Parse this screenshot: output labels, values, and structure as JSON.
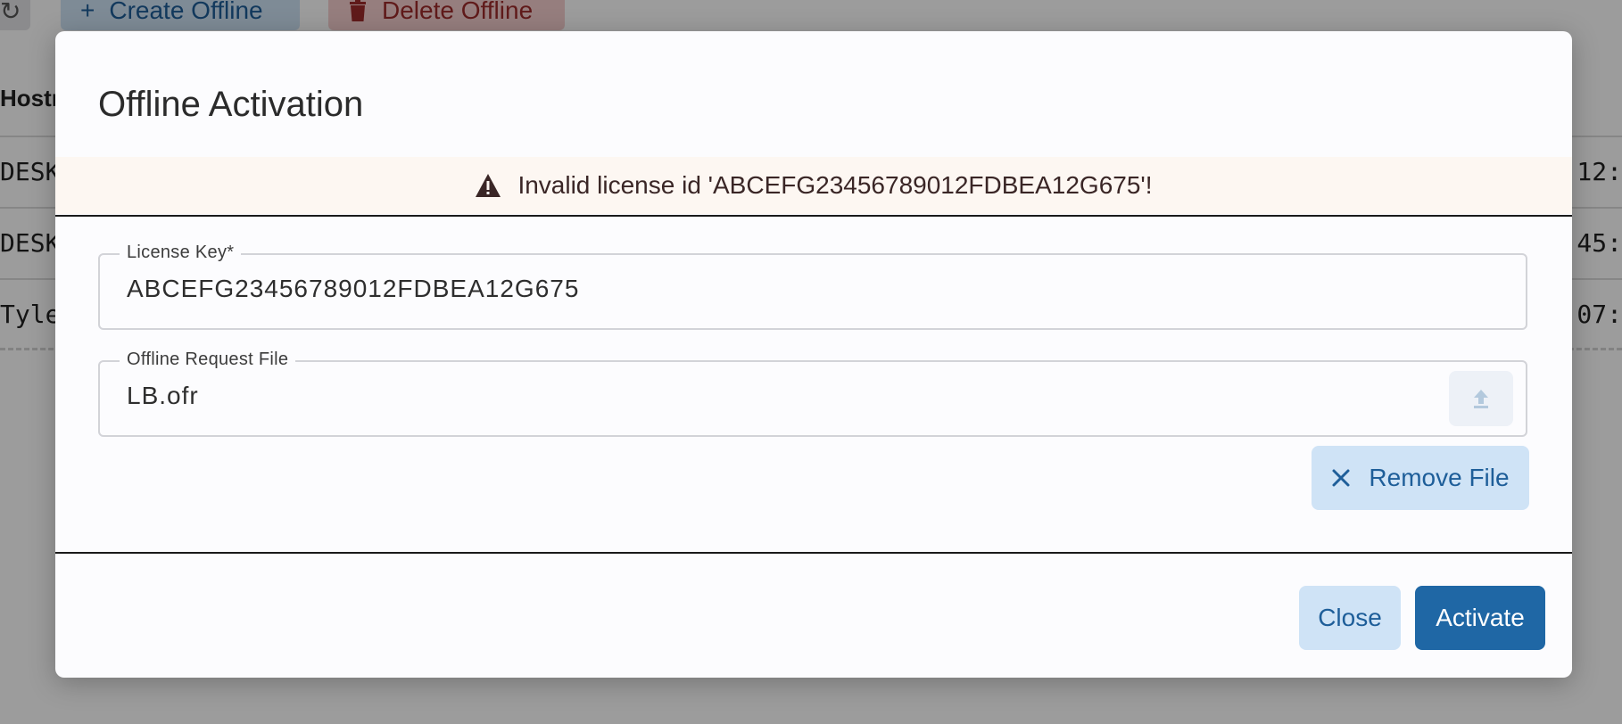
{
  "background": {
    "toolbar": {
      "create_label": "Create Offline",
      "delete_label": "Delete Offline"
    },
    "table": {
      "header_partial": "Hostn",
      "rows": [
        {
          "left": "DESK",
          "right": "12:"
        },
        {
          "left": "DESK",
          "right": "45:"
        },
        {
          "left": "Tyle",
          "right": "07:"
        }
      ]
    }
  },
  "dialog": {
    "title": "Offline Activation",
    "alert": {
      "icon": "warning-icon",
      "message": "Invalid license id 'ABCEFG23456789012FDBEA12G675'!"
    },
    "license_key": {
      "label": "License Key*",
      "value": "ABCEFG23456789012FDBEA12G675"
    },
    "request_file": {
      "label": "Offline Request File",
      "value": "LB.ofr",
      "upload_icon": "upload-icon"
    },
    "remove_file_label": "Remove File",
    "footer": {
      "close_label": "Close",
      "activate_label": "Activate"
    }
  },
  "colors": {
    "primary": "#1f67a5",
    "primary_light": "#cfe3f6",
    "danger_light": "#f6cfcf",
    "alert_bg": "#fdf7f2"
  }
}
